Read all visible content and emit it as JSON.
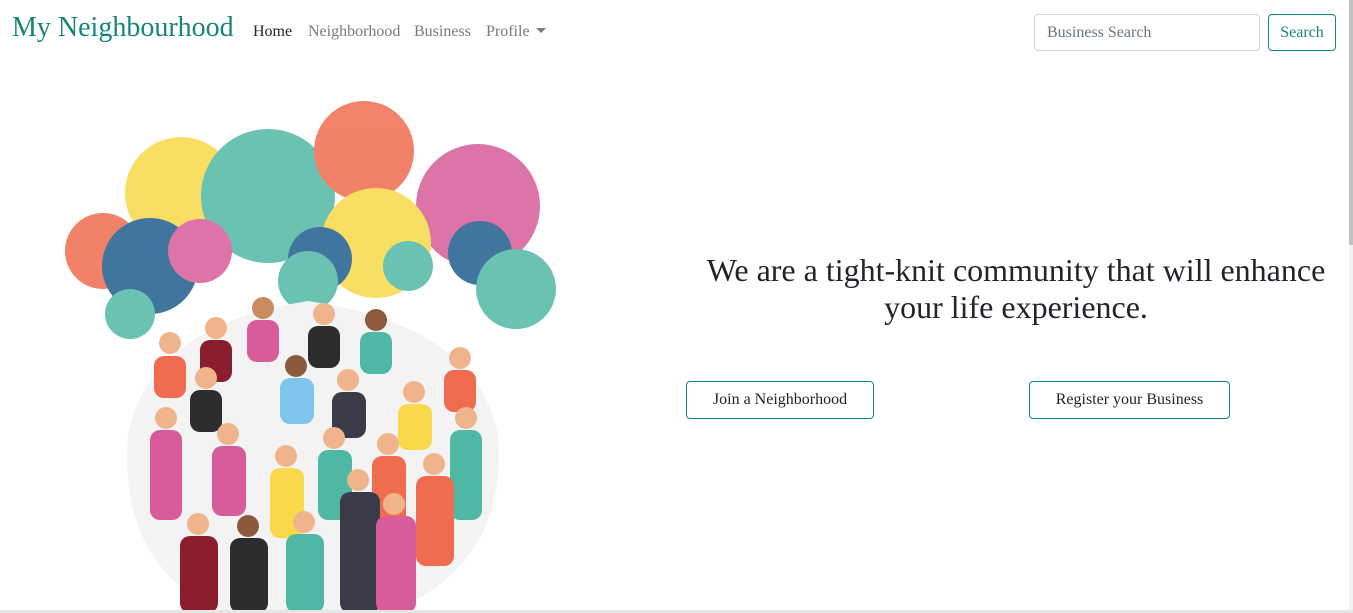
{
  "navbar": {
    "brand": "My Neighbourhood",
    "links": [
      {
        "label": "Home",
        "active": true
      },
      {
        "label": "Neighborhood",
        "active": false
      },
      {
        "label": "Business",
        "active": false
      },
      {
        "label": "Profile",
        "active": false,
        "dropdown": true
      }
    ],
    "search": {
      "placeholder": "Business Search",
      "value": "",
      "button_label": "Search"
    }
  },
  "hero": {
    "tagline": "We are a tight-knit community that will enhance your life experience.",
    "buttons": {
      "join_label": "Join a Neighborhood",
      "register_label": "Register your Business"
    },
    "illustration": "crowd of diverse people with colorful speech bubbles"
  },
  "colors": {
    "brand": "#17857b",
    "text": "#212529",
    "muted_nav": "#7a7a7a"
  }
}
